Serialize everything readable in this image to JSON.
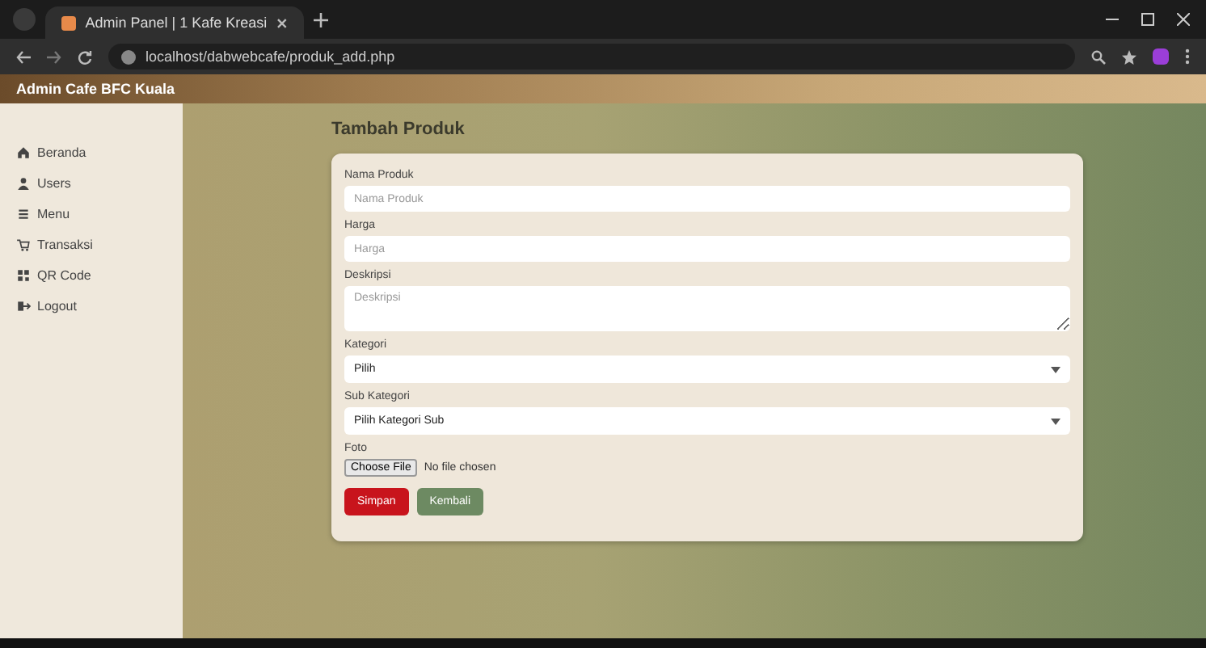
{
  "browser": {
    "tab_title": "Admin Panel | 1 Kafe Kreasi",
    "url": "localhost/dabwebcafe/produk_add.php"
  },
  "header": {
    "brand": "Admin Cafe BFC Kuala"
  },
  "sidebar": {
    "items": [
      {
        "label": "Beranda"
      },
      {
        "label": "Users"
      },
      {
        "label": "Menu"
      },
      {
        "label": "Transaksi"
      },
      {
        "label": "QR Code"
      },
      {
        "label": "Logout"
      }
    ]
  },
  "form": {
    "title": "Tambah Produk",
    "fields": [
      {
        "kind": "input",
        "label": "Nama Produk",
        "placeholder": "Nama Produk"
      },
      {
        "kind": "input",
        "label": "Harga",
        "placeholder": "Harga"
      },
      {
        "kind": "textarea",
        "label": "Deskripsi",
        "placeholder": "Deskripsi"
      },
      {
        "kind": "select",
        "label": "Kategori",
        "value": "Pilih"
      },
      {
        "kind": "select",
        "label": "Sub Kategori",
        "value": "Pilih Kategori Sub"
      },
      {
        "kind": "file",
        "label": "Foto",
        "button": "Choose File",
        "status": "No file chosen"
      }
    ],
    "buttons": [
      {
        "kind": "danger",
        "label": "Simpan"
      },
      {
        "kind": "secondary",
        "label": "Kembali"
      }
    ]
  }
}
